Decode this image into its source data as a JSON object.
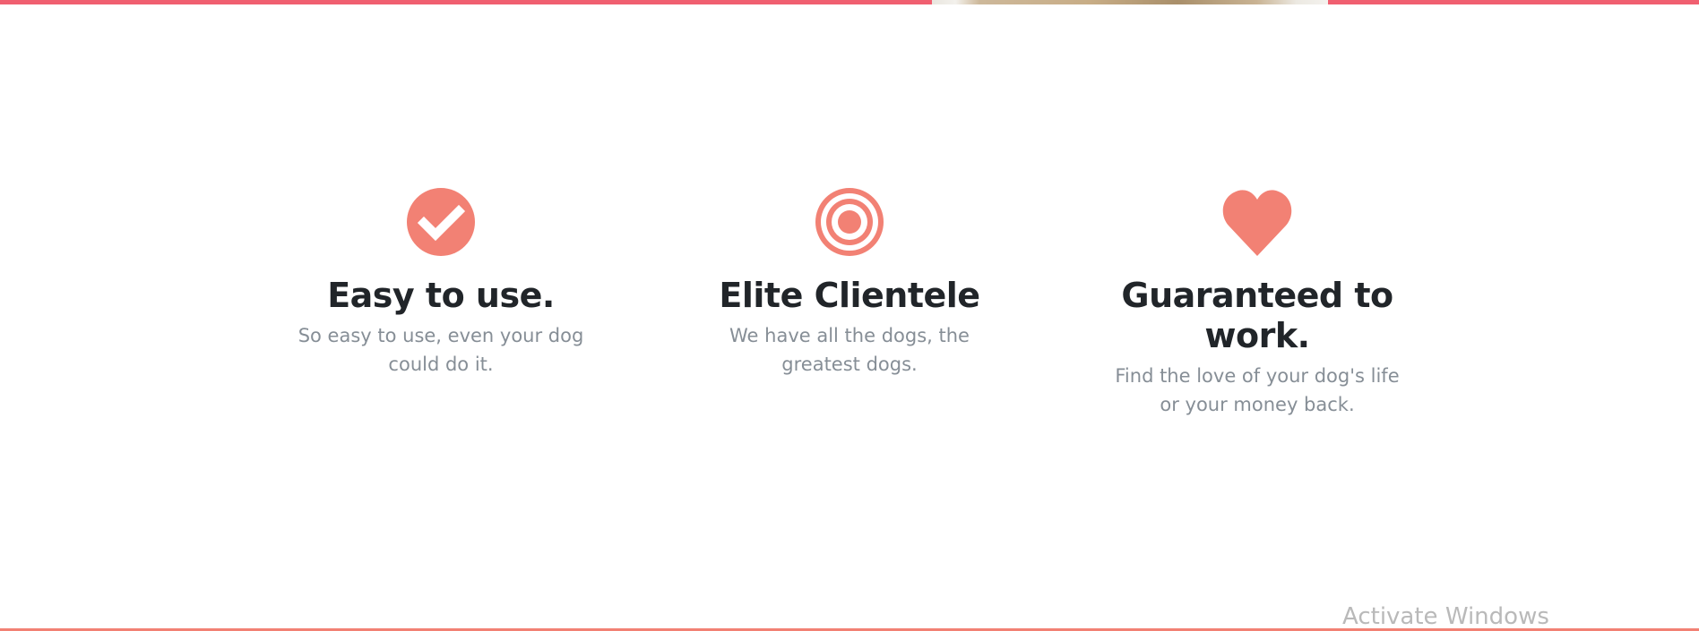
{
  "colors": {
    "accent": "#f05f70",
    "icon": "#f28174",
    "heading": "#212529",
    "body_text": "#868e96",
    "bottom_line": "#f28174"
  },
  "features": [
    {
      "icon": "check-circle-icon",
      "title": "Easy to use.",
      "description": "So easy to use, even your dog could do it."
    },
    {
      "icon": "target-icon",
      "title": "Elite Clientele",
      "description": "We have all the dogs, the greatest dogs."
    },
    {
      "icon": "heart-icon",
      "title": "Guaranteed to work.",
      "description": "Find the love of your dog's life or your money back."
    }
  ],
  "watermark": {
    "text": "Activate Windows"
  }
}
